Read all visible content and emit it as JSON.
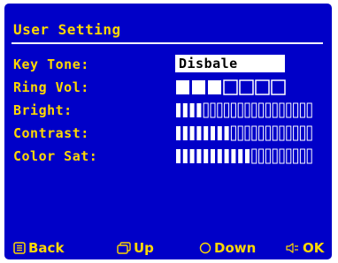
{
  "title": "User Setting",
  "rows": [
    {
      "label": "Key Tone:",
      "value": "Disbale"
    },
    {
      "label": "Ring Vol:",
      "level": 3,
      "max": 7
    },
    {
      "label": "Bright:",
      "level": 4,
      "max": 20
    },
    {
      "label": "Contrast:",
      "level": 8,
      "max": 20
    },
    {
      "label": "Color Sat:",
      "level": 11,
      "max": 20
    }
  ],
  "footer": {
    "back": {
      "label": "Back",
      "icon": "menu-icon"
    },
    "up": {
      "label": "Up",
      "icon": "window-icon"
    },
    "down": {
      "label": "Down",
      "icon": "circle-icon"
    },
    "ok": {
      "label": "OK",
      "icon": "speaker-icon"
    }
  },
  "colors": {
    "background": "#0000c8",
    "accent": "#ffd800",
    "foreground": "#ffffff"
  }
}
